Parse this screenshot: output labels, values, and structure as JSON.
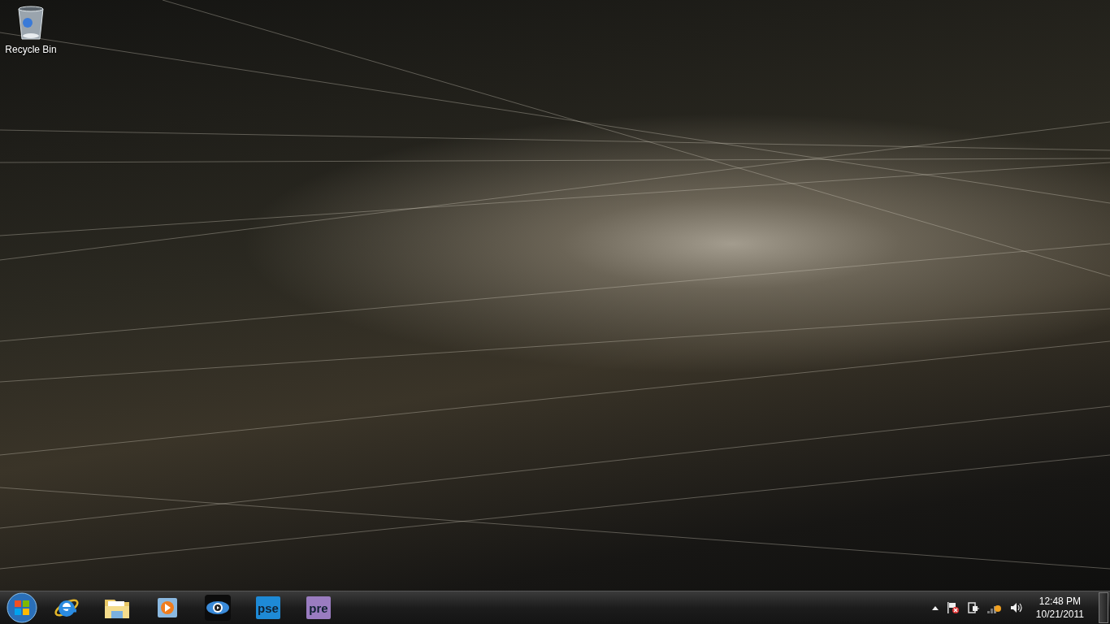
{
  "desktop_icons": [
    {
      "kind": "recycle-bin",
      "label": "Recycle Bin"
    }
  ],
  "taskbar": {
    "pinned": [
      {
        "kind": "ie"
      },
      {
        "kind": "explorer"
      },
      {
        "kind": "media-player"
      },
      {
        "kind": "media-center"
      },
      {
        "kind": "badge",
        "label": "pse",
        "color": "#1e8ad6"
      },
      {
        "kind": "badge",
        "label": "pre",
        "color": "#9a7cc0"
      }
    ],
    "tray": [
      {
        "kind": "arrow"
      },
      {
        "kind": "flag"
      },
      {
        "kind": "power"
      },
      {
        "kind": "network"
      },
      {
        "kind": "volume"
      }
    ],
    "time": "12:48 PM",
    "date": "10/21/2011"
  }
}
